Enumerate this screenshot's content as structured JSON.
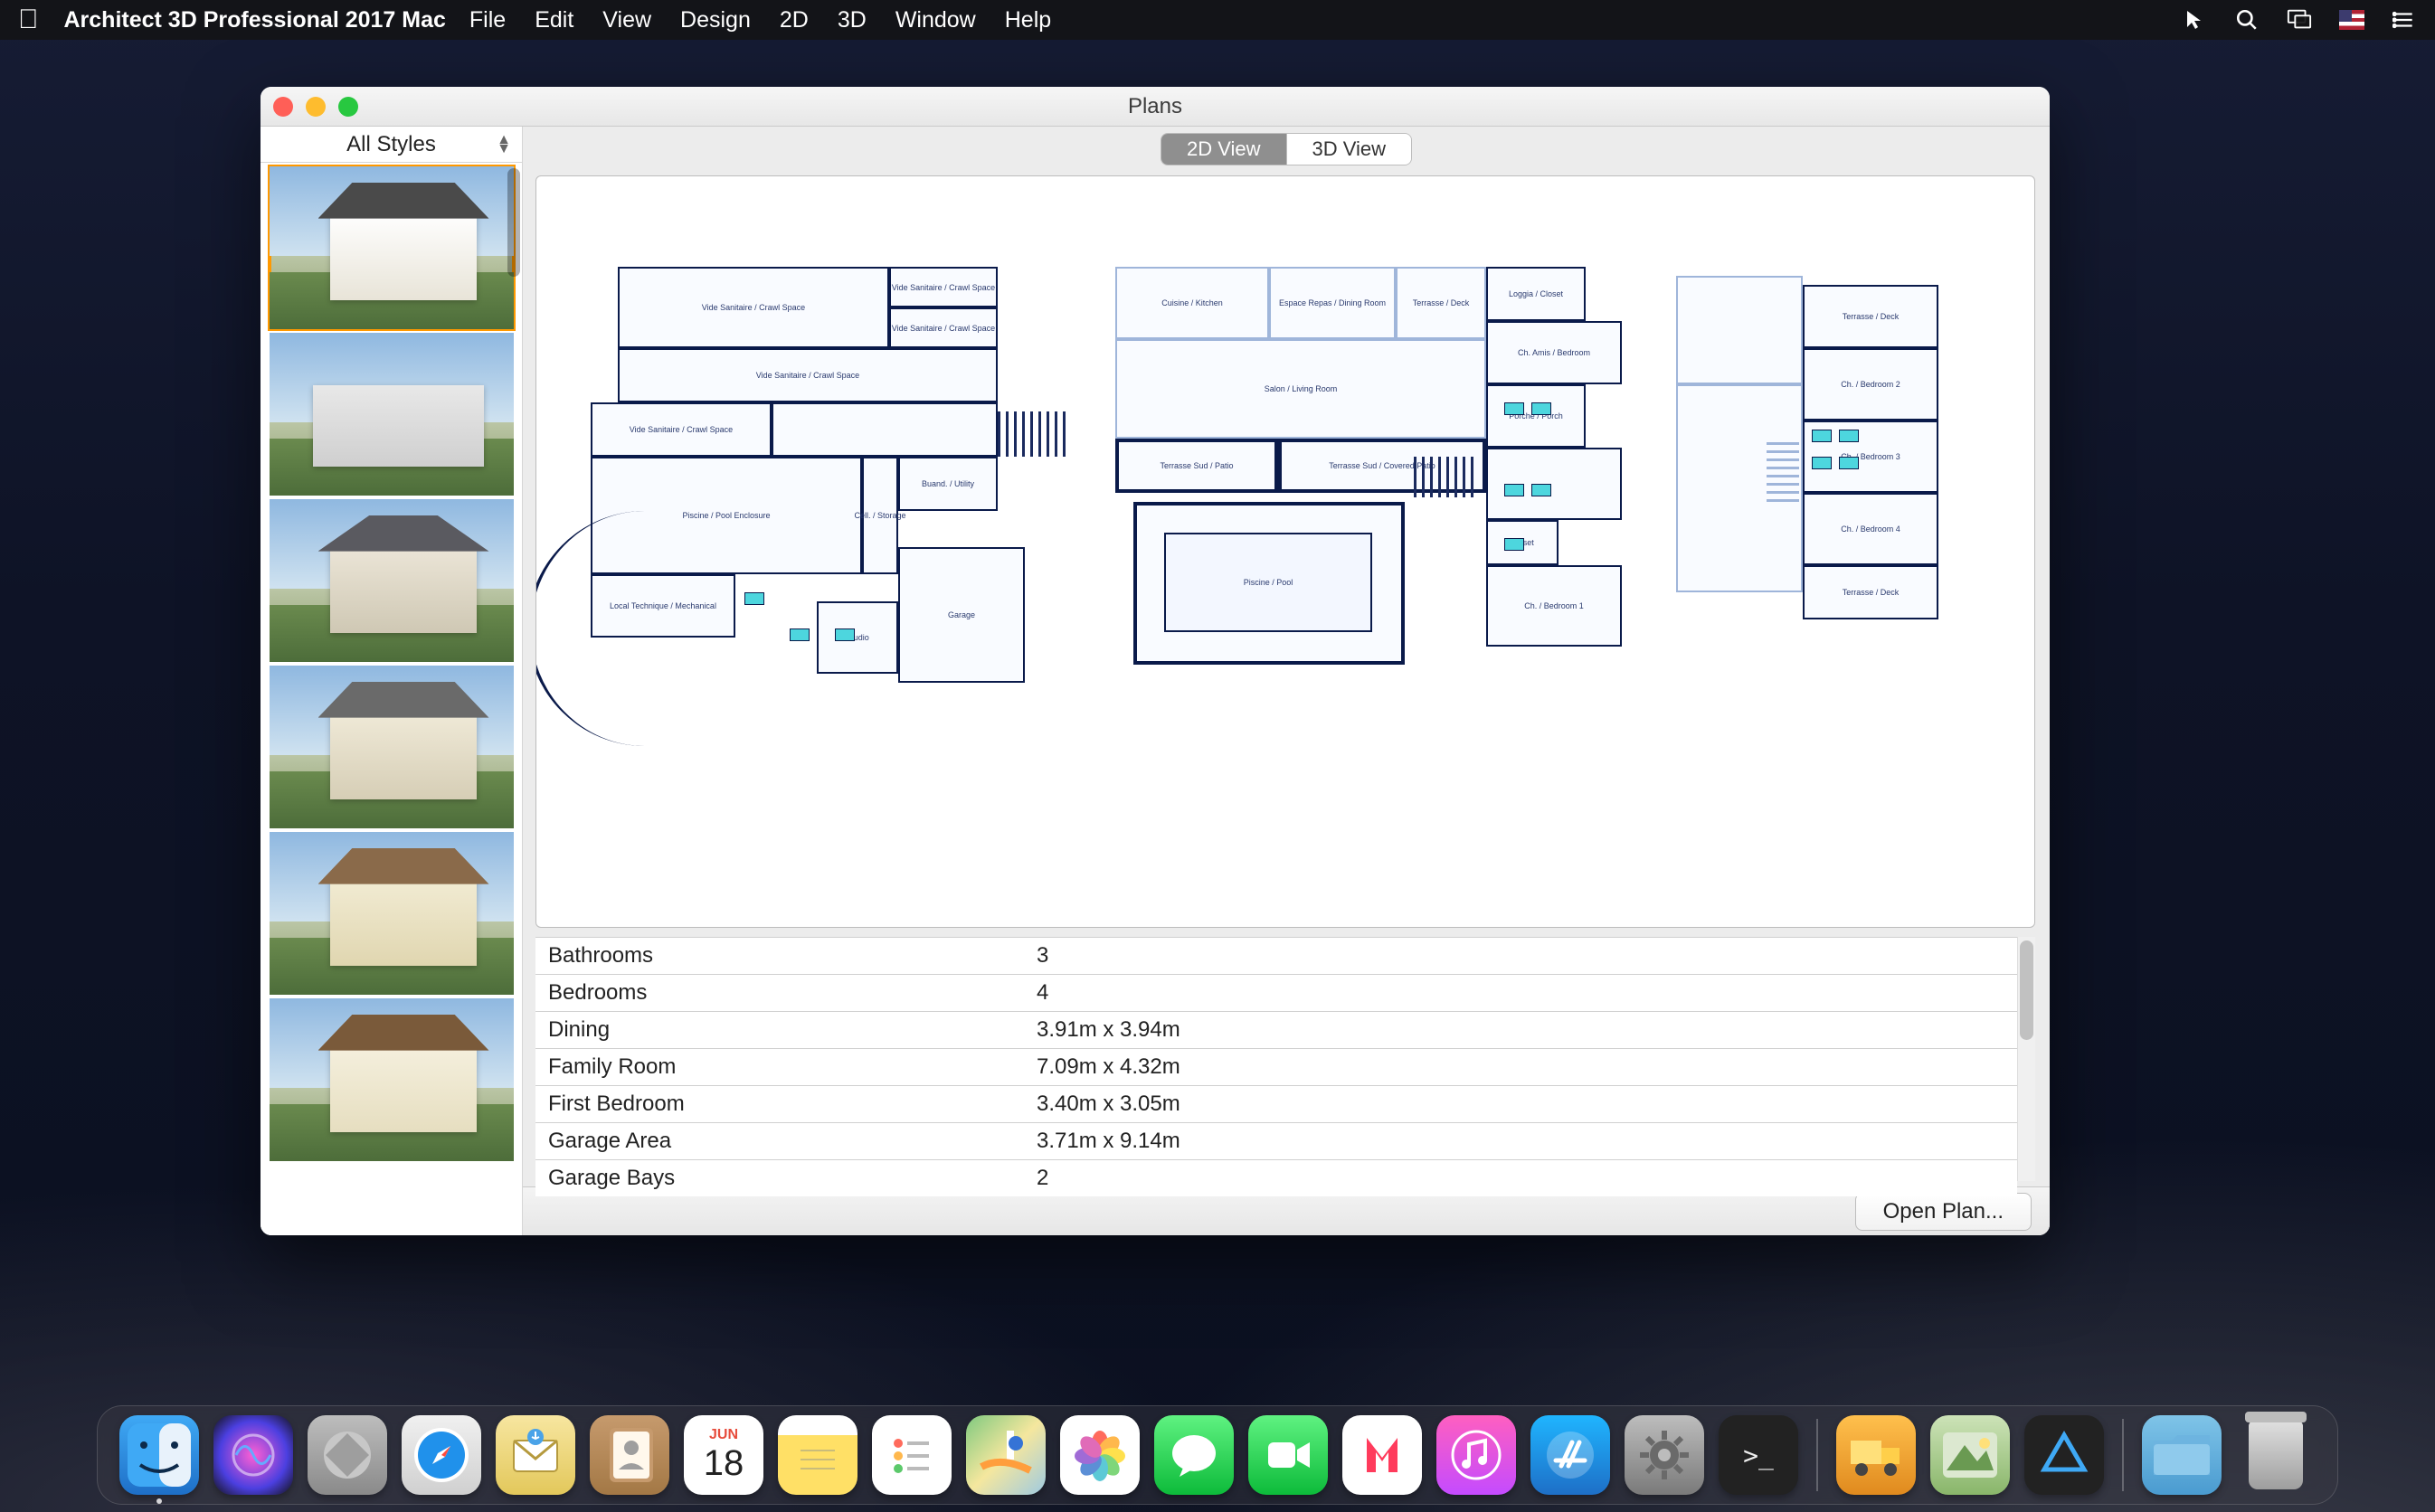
{
  "menubar": {
    "app_name": "Architect 3D Professional 2017 Mac",
    "items": [
      "File",
      "Edit",
      "View",
      "Design",
      "2D",
      "3D",
      "Window",
      "Help"
    ]
  },
  "window": {
    "title": "Plans",
    "style_selector": "All Styles",
    "view_tabs": {
      "tab_2d": "2D View",
      "tab_3d": "3D View",
      "active": "2d"
    },
    "floor_labels": {
      "f1": {
        "a": "Vide Sanitaire / Crawl Space",
        "b": "Vide Sanitaire / Crawl Space",
        "c": "Vide Sanitaire / Crawl Space",
        "d": "Vide Sanitaire / Crawl Space",
        "e": "Vide Sanitaire / Crawl Space",
        "pool": "Piscine / Pool Enclosure",
        "lt": "Local Technique / Mechanical",
        "buanderie": "Buand. / Utility",
        "garage": "Garage",
        "studio": "Studio",
        "cell": "Cell. / Storage"
      },
      "f2": {
        "kitchen": "Cuisine / Kitchen",
        "dining": "Espace Repas / Dining Room",
        "salon": "Salon / Living Room",
        "terr_sud": "Terrasse Sud / Patio",
        "terr_couv": "Terrasse Sud / Covered Patio",
        "loggia": "Loggia / Closet",
        "ch_amis": "Ch. Amis / Bedroom",
        "porch": "Porche / Porch",
        "closet": "Closet",
        "ch1": "Ch. / Bedroom 1",
        "terr_nord": "Terrasse / Deck",
        "pool": "Piscine / Pool"
      },
      "f3": {
        "terr": "Terrasse / Deck",
        "ch2": "Ch. / Bedroom 2",
        "ch3": "Ch. / Bedroom 3",
        "ch4": "Ch. / Bedroom 4",
        "terr2": "Terrasse / Deck"
      }
    },
    "details": [
      {
        "label": "Bathrooms",
        "value": "3"
      },
      {
        "label": "Bedrooms",
        "value": "4"
      },
      {
        "label": "Dining",
        "value": "3.91m x 3.94m"
      },
      {
        "label": "Family Room",
        "value": "7.09m x 4.32m"
      },
      {
        "label": "First Bedroom",
        "value": "3.40m x 3.05m"
      },
      {
        "label": "Garage Area",
        "value": "3.71m x 9.14m"
      },
      {
        "label": "Garage Bays",
        "value": "2"
      }
    ],
    "open_button": "Open Plan..."
  },
  "dock": {
    "calendar": {
      "month": "JUN",
      "day": "18"
    }
  }
}
